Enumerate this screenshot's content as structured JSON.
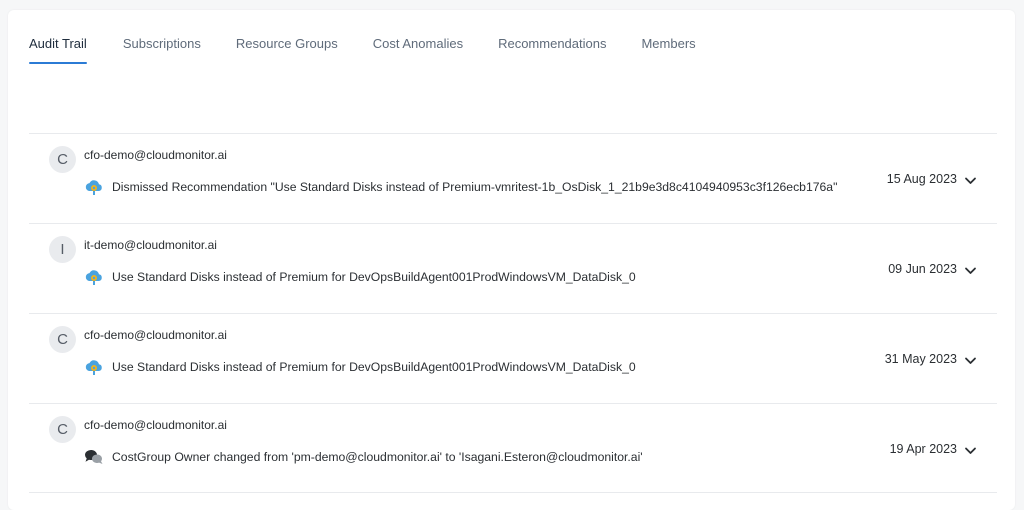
{
  "tabs": [
    {
      "label": "Audit Trail",
      "active": true
    },
    {
      "label": "Subscriptions",
      "active": false
    },
    {
      "label": "Resource Groups",
      "active": false
    },
    {
      "label": "Cost Anomalies",
      "active": false
    },
    {
      "label": "Recommendations",
      "active": false
    },
    {
      "label": "Members",
      "active": false
    }
  ],
  "colors": {
    "accent": "#2b7bd5",
    "cloud": "#4aa3df",
    "gear": "#f2b31b"
  },
  "entries": [
    {
      "avatar": "C",
      "email": "cfo-demo@cloudmonitor.ai",
      "icon": "cloud-gear-icon",
      "message": "Dismissed Recommendation \"Use Standard Disks instead of Premium-vmritest-1b_OsDisk_1_21b9e3d8c4104940953c3f126ecb176a\"",
      "date": "15 Aug 2023"
    },
    {
      "avatar": "I",
      "email": "it-demo@cloudmonitor.ai",
      "icon": "cloud-gear-icon",
      "message": "Use Standard Disks instead of Premium for DevOpsBuildAgent001ProdWindowsVM_DataDisk_0",
      "date": "09 Jun 2023"
    },
    {
      "avatar": "C",
      "email": "cfo-demo@cloudmonitor.ai",
      "icon": "cloud-gear-icon",
      "message": "Use Standard Disks instead of Premium for DevOpsBuildAgent001ProdWindowsVM_DataDisk_0",
      "date": "31 May 2023"
    },
    {
      "avatar": "C",
      "email": "cfo-demo@cloudmonitor.ai",
      "icon": "chat-bubbles-icon",
      "message": "CostGroup Owner changed from 'pm-demo@cloudmonitor.ai' to 'Isagani.Esteron@cloudmonitor.ai'",
      "date": "19 Apr 2023"
    }
  ]
}
